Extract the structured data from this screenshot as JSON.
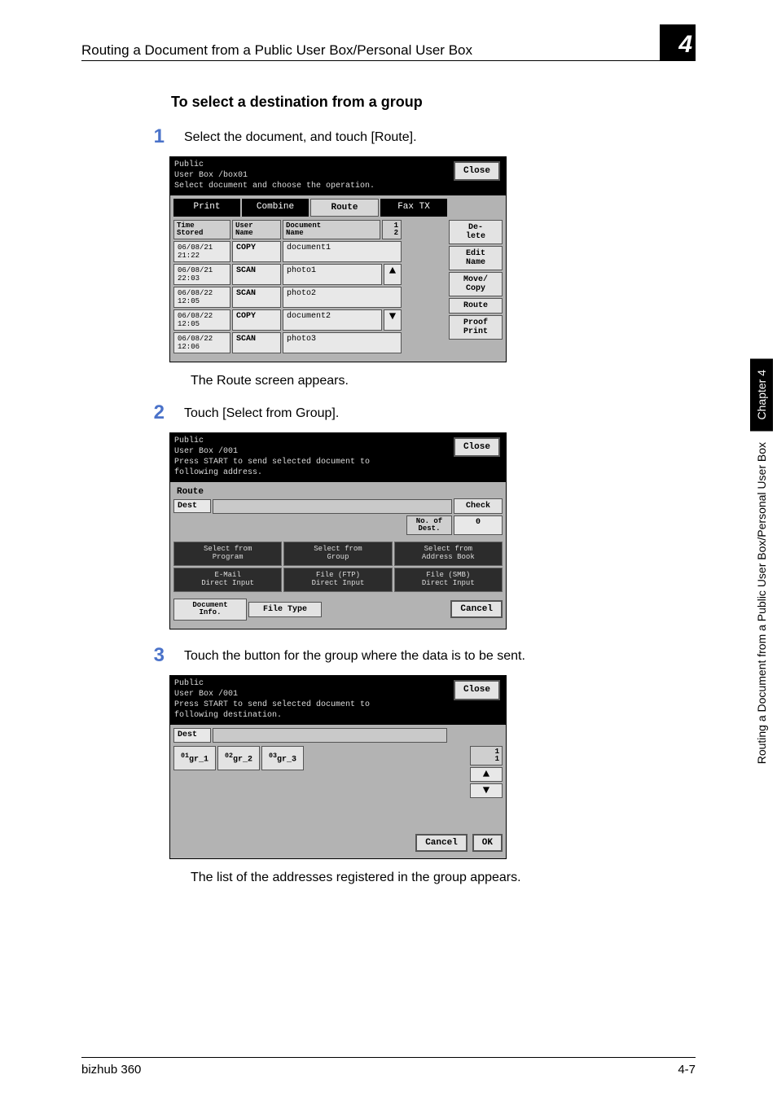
{
  "header": {
    "title": "Routing a Document from a Public User Box/Personal User Box",
    "chapter_digit": "4"
  },
  "section_heading": "To select a destination from a group",
  "steps": {
    "s1": {
      "num": "1",
      "text": "Select the document, and touch [Route]."
    },
    "s2": {
      "num": "2",
      "text": "Touch [Select from Group]."
    },
    "s3": {
      "num": "3",
      "text": "Touch the button for the group where the data is to be sent."
    }
  },
  "body": {
    "after1": "The Route screen appears.",
    "after3": "The list of the addresses registered in the group appears."
  },
  "ui1": {
    "title_l1": "Public",
    "title_l2": "User Box   /box01",
    "subtitle": "Select document and choose the operation.",
    "close": "Close",
    "tabs": {
      "print": "Print",
      "combine": "Combine",
      "route": "Route",
      "fax": "Fax TX"
    },
    "cols": {
      "time": "Time\nStored",
      "user": "User\nName",
      "doc": "Document\nName",
      "pg": "1\n2"
    },
    "rows": [
      {
        "t": "06/08/21\n21:22",
        "u": "COPY",
        "d": "document1"
      },
      {
        "t": "06/08/21\n22:03",
        "u": "SCAN",
        "d": "photo1"
      },
      {
        "t": "06/08/22\n12:05",
        "u": "SCAN",
        "d": "photo2"
      },
      {
        "t": "06/08/22\n12:05",
        "u": "COPY",
        "d": "document2"
      },
      {
        "t": "06/08/22\n12:06",
        "u": "SCAN",
        "d": "photo3"
      }
    ],
    "side": {
      "delete": "De-\nlete",
      "edit": "Edit\nName",
      "move": "Move/\nCopy",
      "route": "Route",
      "proof": "Proof\nPrint"
    }
  },
  "ui2": {
    "title_l1": "Public",
    "title_l2": "User Box   /001",
    "subtitle": "Press START to send selected document to\nfollowing address.",
    "close": "Close",
    "route": "Route",
    "dest": "Dest",
    "check": "Check",
    "nod_label": "No. of\nDest.",
    "nod_val": "0",
    "btns": {
      "b1": "Select from\nProgram",
      "b2": "Select from\nGroup",
      "b3": "Select from\nAddress Book",
      "b4": "E-Mail\nDirect Input",
      "b5": "File (FTP)\nDirect Input",
      "b6": "File (SMB)\nDirect Input"
    },
    "docinfo": "Document\nInfo.",
    "filetype": "File Type",
    "cancel": "Cancel"
  },
  "ui3": {
    "title_l1": "Public",
    "title_l2": "User Box   /001",
    "subtitle": "Press START to send selected document to\nfollowing destination.",
    "close": "Close",
    "dest": "Dest",
    "g1_pre": "01",
    "g1": "gr_1",
    "g2_pre": "02",
    "g2": "gr_2",
    "g3_pre": "03",
    "g3": "gr_3",
    "page": "1\n1",
    "cancel": "Cancel",
    "ok": "OK"
  },
  "side_tab": {
    "black": "Chapter 4",
    "plain": "Routing a Document from a Public User Box/Personal User Box"
  },
  "footer": {
    "left": "bizhub 360",
    "right": "4-7"
  }
}
